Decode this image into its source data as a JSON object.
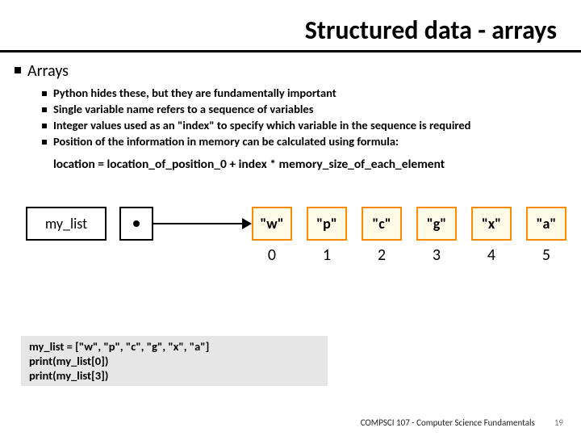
{
  "title": "Structured data - arrays",
  "heading": "Arrays",
  "bullets": [
    "Python hides these, but they are fundamentally important",
    "Single variable name refers to a sequence of variables",
    "Integer values used as an \"index\" to specify which variable in the sequence is required",
    "Position of the information in memory can be calculated using formula:"
  ],
  "formula": "location = location_of_position_0 + index * memory_size_of_each_element",
  "diagram": {
    "var_label": "my_list",
    "cells": [
      "\"w\"",
      "\"p\"",
      "\"c\"",
      "\"g\"",
      "\"x\"",
      "\"a\""
    ],
    "indices": [
      "0",
      "1",
      "2",
      "3",
      "4",
      "5"
    ]
  },
  "code": {
    "line1": "my_list = [\"w\", \"p\", \"c\", \"g\", \"x\", \"a\"]",
    "line2": "print(my_list[0])",
    "line3": "print(my_list[3])"
  },
  "footer": {
    "course": "COMPSCI 107 - Computer Science Fundamentals",
    "page": "19"
  }
}
